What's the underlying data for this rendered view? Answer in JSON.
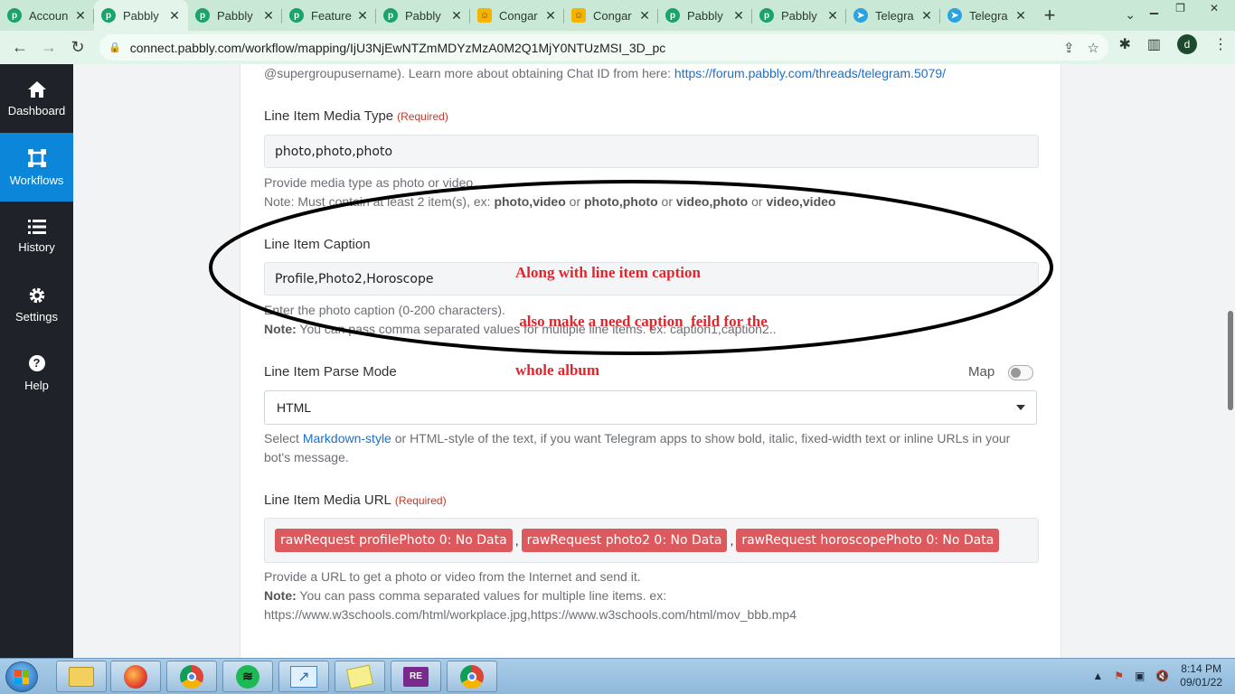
{
  "browser": {
    "tabs": [
      {
        "label": "Accoun",
        "icon": "pabbly"
      },
      {
        "label": "Pabbly",
        "icon": "pabbly",
        "active": true
      },
      {
        "label": "Pabbly",
        "icon": "pabbly"
      },
      {
        "label": "Feature",
        "icon": "pabbly"
      },
      {
        "label": "Pabbly",
        "icon": "pabbly"
      },
      {
        "label": "Congar",
        "icon": "congrats"
      },
      {
        "label": "Congar",
        "icon": "congrats"
      },
      {
        "label": "Pabbly",
        "icon": "pabbly"
      },
      {
        "label": "Pabbly",
        "icon": "pabbly"
      },
      {
        "label": "Telegra",
        "icon": "telegram"
      },
      {
        "label": "Telegra",
        "icon": "telegram"
      }
    ],
    "url": "connect.pabbly.com/workflow/mapping/IjU3NjEwNTZmMDYzMzA0M2Q1MjY0NTUzMSI_3D_pc",
    "profile_initial": "d"
  },
  "sidebar": {
    "items": [
      {
        "label": "Dashboard",
        "icon": "home-icon"
      },
      {
        "label": "Workflows",
        "icon": "workflow-icon",
        "active": true
      },
      {
        "label": "History",
        "icon": "history-icon"
      },
      {
        "label": "Settings",
        "icon": "gear-icon"
      },
      {
        "label": "Help",
        "icon": "help-icon"
      }
    ]
  },
  "form": {
    "chat_id_help": {
      "text": "@supergroupusername). Learn more about obtaining Chat ID from here: ",
      "link": "https://forum.pabbly.com/threads/telegram.5079/"
    },
    "media_type": {
      "label": "Line Item Media Type",
      "required": "(Required)",
      "value": "photo,photo,photo",
      "help1": "Provide media type as photo or video.",
      "help2_prefix": "Note: Must contain at least 2 item(s), ex: ",
      "ex1": "photo,video",
      "or1": " or ",
      "ex2": "photo,photo",
      "or2": " or ",
      "ex3": "video,photo",
      "or3": " or ",
      "ex4": "video,video"
    },
    "caption": {
      "label": "Line Item Caption",
      "value": "Profile,Photo2,Horoscope",
      "help1": "Enter the photo caption (0-200 characters).",
      "note_label": "Note:",
      "note_text": " You can pass comma separated values for multiple line items. ex: caption1,caption2.."
    },
    "parse_mode": {
      "label": "Line Item Parse Mode",
      "map_label": "Map",
      "map_enabled": false,
      "value": "HTML",
      "help_prefix": "Select ",
      "help_link": "Markdown-style",
      "help_suffix": " or HTML-style of the text, if you want Telegram apps to show bold, italic, fixed-width text or inline URLs in your",
      "help_line2": "bot's message."
    },
    "media_url": {
      "label": "Line Item Media URL",
      "required": "(Required)",
      "tags": [
        "rawRequest profilePhoto 0: No Data",
        "rawRequest photo2 0: No Data",
        "rawRequest horoscopePhoto 0: No Data"
      ],
      "separator": ",",
      "help1": "Provide a URL to get a photo or video from the Internet and send it.",
      "note_label": "Note:",
      "note_text": " You can pass comma separated values for multiple line items. ex:",
      "example": "https://www.w3schools.com/html/workplace.jpg,https://www.w3schools.com/html/mov_bbb.mp4"
    }
  },
  "annotation": {
    "line1": "Along with line item caption",
    "line2": " also make a need caption  feild for the",
    "line3": "whole album",
    "color": "#e0262c"
  },
  "taskbar": {
    "time": "8:14 PM",
    "date": "09/01/22",
    "apps": [
      "file-explorer",
      "firefox",
      "chrome",
      "spotify",
      "snipping-tool",
      "sticky-notes",
      "rar",
      "chrome"
    ]
  }
}
